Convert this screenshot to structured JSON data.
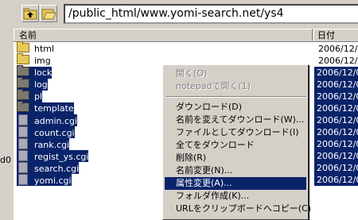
{
  "toolbar": {
    "path": "/public_html/www.yomi-search.net/ys4"
  },
  "left_pane": {
    "label": "d0"
  },
  "list": {
    "columns": {
      "name": "名前",
      "date": "日付"
    },
    "rows": [
      {
        "name": "html",
        "type": "folder",
        "date": "2006/12/0",
        "selected": false
      },
      {
        "name": "img",
        "type": "folder",
        "date": "2006/12/0",
        "selected": false
      },
      {
        "name": "lock",
        "type": "folder",
        "date": "2006/12/0",
        "selected": true
      },
      {
        "name": "log",
        "type": "folder",
        "date": "2006/12/0",
        "selected": true
      },
      {
        "name": "pl",
        "type": "folder",
        "date": "2006/12/0",
        "selected": true
      },
      {
        "name": "template",
        "type": "folder",
        "date": "2006/12/0",
        "selected": true
      },
      {
        "name": "admin.cgi",
        "type": "file",
        "date": "2006/12/0",
        "selected": true
      },
      {
        "name": "count.cgi",
        "type": "file",
        "date": "2006/12/0",
        "selected": true
      },
      {
        "name": "rank.cgi",
        "type": "file",
        "date": "2006/12/0",
        "selected": true
      },
      {
        "name": "regist_ys.cgi",
        "type": "file",
        "date": "2006/12/0",
        "selected": true
      },
      {
        "name": "search.cgi",
        "type": "file",
        "date": "2006/12/0",
        "selected": true
      },
      {
        "name": "yomi.cgi",
        "type": "file",
        "date": "2006/12/0",
        "selected": true
      }
    ]
  },
  "context_menu": {
    "items": [
      {
        "label": "開く(O)",
        "disabled": true
      },
      {
        "label": "notepadで開く(1)",
        "disabled": true
      },
      {
        "separator": true
      },
      {
        "label": "ダウンロード(D)"
      },
      {
        "label": "名前を変えてダウンロード(W)..."
      },
      {
        "label": "ファイルとしてダウンロード(I)"
      },
      {
        "label": "全てをダウンロード"
      },
      {
        "label": "削除(R)"
      },
      {
        "label": "名前変更(N)..."
      },
      {
        "label": "属性変更(A)...",
        "highlighted": true
      },
      {
        "label": "フォルダ作成(K)..."
      },
      {
        "label": "URLをクリップボードへコピー(C)"
      }
    ]
  }
}
